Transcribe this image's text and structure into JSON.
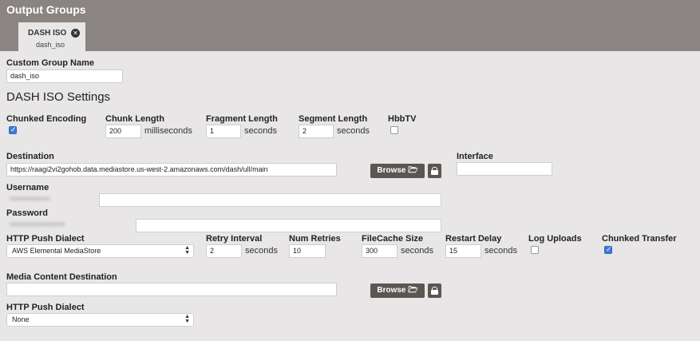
{
  "header": {
    "title": "Output Groups"
  },
  "tab": {
    "label": "DASH ISO",
    "sublabel": "dash_iso",
    "close_icon": "close-circle-icon"
  },
  "custom_group_name": {
    "label": "Custom Group Name",
    "value": "dash_iso"
  },
  "section_title": "DASH ISO Settings",
  "chunked_encoding": {
    "label": "Chunked Encoding",
    "checked": true
  },
  "chunk_length": {
    "label": "Chunk Length",
    "value": "200",
    "unit": "milliseconds"
  },
  "fragment_length": {
    "label": "Fragment Length",
    "value": "1",
    "unit": "seconds"
  },
  "segment_length": {
    "label": "Segment Length",
    "value": "2",
    "unit": "seconds"
  },
  "hbbtv": {
    "label": "HbbTV",
    "checked": false
  },
  "destination": {
    "label": "Destination",
    "value": "https://raagi2vi2gohob.data.mediastore.us-west-2.amazonaws.com/dash/ull/main",
    "browse_label": "Browse"
  },
  "interface": {
    "label": "Interface",
    "value": ""
  },
  "username": {
    "label": "Username",
    "value": ""
  },
  "password": {
    "label": "Password",
    "value": ""
  },
  "http_push_dialect": {
    "label": "HTTP Push Dialect",
    "value": "AWS Elemental MediaStore"
  },
  "retry_interval": {
    "label": "Retry Interval",
    "value": "2",
    "unit": "seconds"
  },
  "num_retries": {
    "label": "Num Retries",
    "value": "10"
  },
  "filecache_size": {
    "label": "FileCache Size",
    "value": "300",
    "unit": "seconds"
  },
  "restart_delay": {
    "label": "Restart Delay",
    "value": "15",
    "unit": "seconds"
  },
  "log_uploads": {
    "label": "Log Uploads",
    "checked": false
  },
  "chunked_transfer": {
    "label": "Chunked Transfer",
    "checked": true
  },
  "media_content_destination": {
    "label": "Media Content Destination",
    "value": "",
    "browse_label": "Browse"
  },
  "http_push_dialect_2": {
    "label": "HTTP Push Dialect",
    "value": "None"
  },
  "colors": {
    "header_bg": "#8a8582",
    "button_bg": "#5c5653",
    "checkbox_on": "#3b7dd8"
  }
}
